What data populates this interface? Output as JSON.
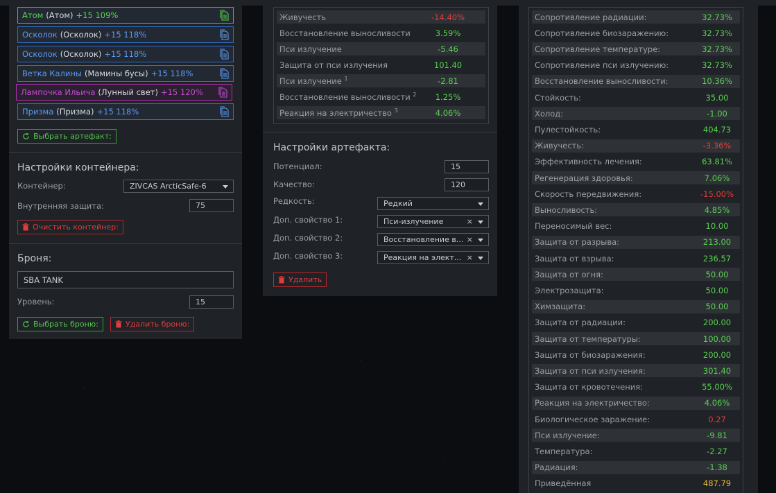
{
  "artifacts": [
    {
      "name": "Атом",
      "sub": "(Атом)",
      "level": "+15 109%",
      "color": "green"
    },
    {
      "name": "Осколок",
      "sub": "(Осколок)",
      "level": "+15 118%",
      "color": "blue"
    },
    {
      "name": "Осколок",
      "sub": "(Осколок)",
      "level": "+15 118%",
      "color": "blue"
    },
    {
      "name": "Ветка Калины",
      "sub": "(Мамины бусы)",
      "level": "+15 118%",
      "color": "blue"
    },
    {
      "name": "Лампочка Ильича",
      "sub": "(Лунный свет)",
      "level": "+15 120%",
      "color": "purple"
    },
    {
      "name": "Призма",
      "sub": "(Призма)",
      "level": "+15 118%",
      "color": "blue"
    }
  ],
  "select_artifact_label": "Выбрать артефакт:",
  "container": {
    "title": "Настройки контейнера:",
    "container_label": "Контейнер:",
    "container_value": "ZIVCAS ArcticSafe-6",
    "inner_protection_label": "Внутренняя защита:",
    "inner_protection_value": "75",
    "clear_label": "Очистить контейнер:"
  },
  "armor": {
    "title": "Броня:",
    "name_value": "SBA TANK",
    "level_label": "Уровень:",
    "level_value": "15",
    "select_label": "Выбрать броню:",
    "delete_label": "Удалить броню:"
  },
  "artifact_stats": [
    {
      "key": "Живучесть",
      "sup": "",
      "value": "-14.40%",
      "tone": "neg"
    },
    {
      "key": "Восстановление выносливости",
      "sup": "",
      "value": "3.59%",
      "tone": "pos"
    },
    {
      "key": "Пси излучение",
      "sup": "",
      "value": "-5.46",
      "tone": "pos"
    },
    {
      "key": "Защита от пси излучения",
      "sup": "",
      "value": "101.40",
      "tone": "pos"
    },
    {
      "key": "Пси излучение",
      "sup": "1",
      "value": "-2.81",
      "tone": "pos"
    },
    {
      "key": "Восстановление выносливости",
      "sup": "2",
      "value": "1.25%",
      "tone": "pos"
    },
    {
      "key": "Реакция на электричество",
      "sup": "3",
      "value": "4.06%",
      "tone": "pos"
    }
  ],
  "artifact_settings": {
    "title": "Настройки артефакта:",
    "potential_label": "Потенциал:",
    "potential_value": "15",
    "quality_label": "Качество:",
    "quality_value": "120",
    "rarity_label": "Редкость:",
    "rarity_value": "Редкий",
    "extra1_label": "Доп. свойство 1:",
    "extra1_value": "Пси-излучение",
    "extra2_label": "Доп. свойство 2:",
    "extra2_value": "Восстановление в...",
    "extra3_label": "Доп. свойство 3:",
    "extra3_value": "Реакция на элект...",
    "delete_label": "Удалить"
  },
  "totals": [
    {
      "key": "Сопротивление радиации:",
      "value": "32.73%",
      "tone": "pos"
    },
    {
      "key": "Сопротивление биозаражению:",
      "value": "32.73%",
      "tone": "pos"
    },
    {
      "key": "Сопротивление температуре:",
      "value": "32.73%",
      "tone": "pos"
    },
    {
      "key": "Сопротивление пси излучению:",
      "value": "32.73%",
      "tone": "pos"
    },
    {
      "key": "Восстановление выносливости:",
      "value": "10.36%",
      "tone": "pos"
    },
    {
      "key": "Стойкость:",
      "value": "35.00",
      "tone": "pos"
    },
    {
      "key": "Холод:",
      "value": "-1.00",
      "tone": "pos"
    },
    {
      "key": "Пулестойкость:",
      "value": "404.73",
      "tone": "pos"
    },
    {
      "key": "Живучесть:",
      "value": "-3.36%",
      "tone": "neg"
    },
    {
      "key": "Эффективность лечения:",
      "value": "63.81%",
      "tone": "pos"
    },
    {
      "key": "Регенерация здоровья:",
      "value": "7.06%",
      "tone": "pos"
    },
    {
      "key": "Скорость передвижения:",
      "value": "-15.00%",
      "tone": "neg"
    },
    {
      "key": "Выносливость:",
      "value": "4.85%",
      "tone": "pos"
    },
    {
      "key": "Переносимый вес:",
      "value": "10.00",
      "tone": "pos"
    },
    {
      "key": "Защита от разрыва:",
      "value": "213.00",
      "tone": "pos"
    },
    {
      "key": "Защита от взрыва:",
      "value": "236.57",
      "tone": "pos"
    },
    {
      "key": "Защита от огня:",
      "value": "50.00",
      "tone": "pos"
    },
    {
      "key": "Электрозащита:",
      "value": "50.00",
      "tone": "pos"
    },
    {
      "key": "Химзащита:",
      "value": "50.00",
      "tone": "pos"
    },
    {
      "key": "Защита от радиации:",
      "value": "200.00",
      "tone": "pos"
    },
    {
      "key": "Защита от температуры:",
      "value": "100.00",
      "tone": "pos"
    },
    {
      "key": "Защита от биозаражения:",
      "value": "200.00",
      "tone": "pos"
    },
    {
      "key": "Защита от пси излучения:",
      "value": "301.40",
      "tone": "pos"
    },
    {
      "key": "Защита от кровотечения:",
      "value": "55.00%",
      "tone": "pos"
    },
    {
      "key": "Реакция на электричество:",
      "value": "4.06%",
      "tone": "pos"
    },
    {
      "key": "Биологическое заражение:",
      "value": "0.27",
      "tone": "neg"
    },
    {
      "key": "Пси излучение:",
      "value": "-9.81",
      "tone": "pos"
    },
    {
      "key": "Температура:",
      "value": "-2.27",
      "tone": "pos"
    },
    {
      "key": "Радиация:",
      "value": "-1.38",
      "tone": "pos"
    },
    {
      "key": "Приведённая",
      "value": "487.79",
      "tone": "yel"
    }
  ]
}
